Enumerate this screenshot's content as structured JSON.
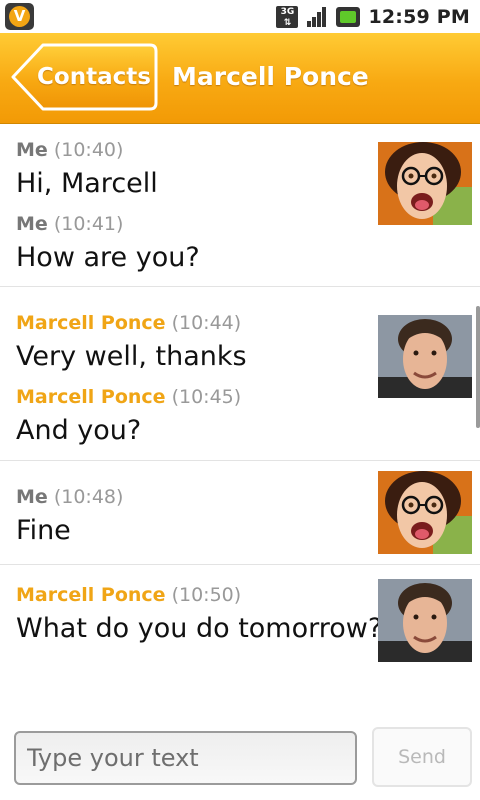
{
  "status_bar": {
    "network": "3G",
    "time": "12:59 PM",
    "icons": [
      "app-notification-icon",
      "network-3g-icon",
      "signal-icon",
      "battery-icon"
    ]
  },
  "header": {
    "back_label": "Contacts",
    "title": "Marcell Ponce"
  },
  "colors": {
    "accent": "#f8a912",
    "sender_other": "#f0a516",
    "sender_me": "#777777"
  },
  "conversation": [
    {
      "avatar": "me-avatar",
      "messages": [
        {
          "sender": "Me",
          "time": "(10:40)",
          "text": "Hi, Marcell"
        },
        {
          "sender": "Me",
          "time": "(10:41)",
          "text": "How are you?"
        }
      ]
    },
    {
      "avatar": "contact-avatar",
      "messages": [
        {
          "sender": "Marcell Ponce",
          "time": "(10:44)",
          "text": "Very well, thanks"
        },
        {
          "sender": "Marcell Ponce",
          "time": "(10:45)",
          "text": "And you?"
        }
      ]
    },
    {
      "avatar": "me-avatar",
      "messages": [
        {
          "sender": "Me",
          "time": "(10:48)",
          "text": "Fine"
        }
      ]
    },
    {
      "avatar": "contact-avatar",
      "messages": [
        {
          "sender": "Marcell Ponce",
          "time": "(10:50)",
          "text": "What do you do tomorrow?"
        }
      ]
    }
  ],
  "composer": {
    "placeholder": "Type your text",
    "value": "",
    "send_label": "Send"
  }
}
